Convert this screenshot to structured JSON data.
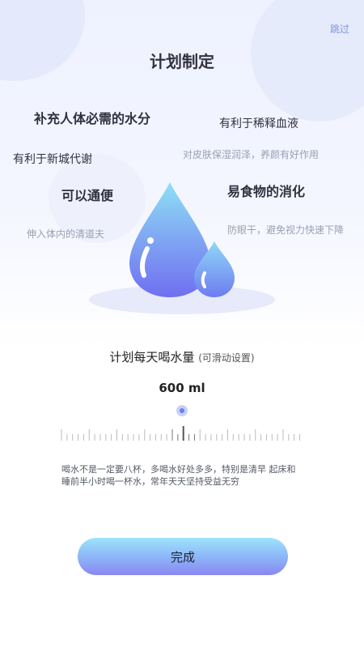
{
  "header": {
    "skip_label": "跳过",
    "title": "计划制定"
  },
  "benefits": {
    "hydration": "补充人体必需的水分",
    "blood": "有利于稀释血液",
    "metabolism": "有利于新城代谢",
    "skin": "对皮肤保湿润泽，养颜有好作用",
    "bowel": "可以通便",
    "digestion": "易食物的消化",
    "cleaner": "伸入体内的清道夫",
    "eyes": "防眼干，避免视力快速下降"
  },
  "plan": {
    "label": "计划每天喝水量",
    "hint": "(可滑动设置)",
    "amount": "600 ml",
    "slider_fraction": 0.5
  },
  "note": "喝水不是一定要八杯，多喝水好处多多，特别是清早 起床和睡前半小时喝一杯水，常年天天坚持受益无穷",
  "done_label": "完成",
  "colors": {
    "accent": "#6b7ef0",
    "drop_light": "#8ee0f5",
    "drop_dark": "#6f6ff0"
  }
}
